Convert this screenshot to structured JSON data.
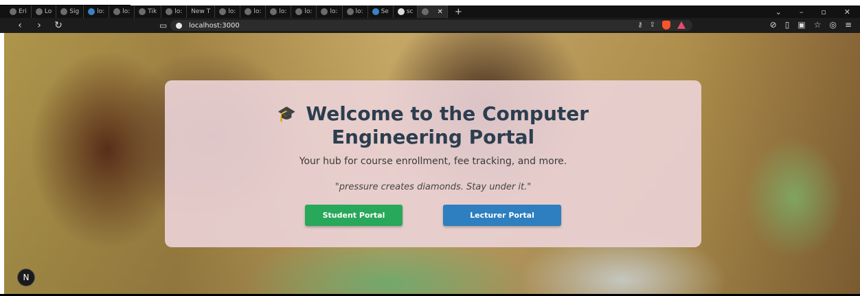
{
  "browser": {
    "tabs": [
      {
        "label": "Eri",
        "icon": "globe-icon"
      },
      {
        "label": "Lo",
        "icon": "globe-icon"
      },
      {
        "label": "Sig",
        "icon": "globe-icon"
      },
      {
        "label": "lo:",
        "icon": "react-icon"
      },
      {
        "label": "lo:",
        "icon": "globe-icon"
      },
      {
        "label": "Tik",
        "icon": "globe-icon"
      },
      {
        "label": "lo:",
        "icon": "globe-icon"
      },
      {
        "label": "New T",
        "icon": ""
      },
      {
        "label": "lo:",
        "icon": "globe-icon"
      },
      {
        "label": "lo:",
        "icon": "globe-icon"
      },
      {
        "label": "lo:",
        "icon": "globe-icon"
      },
      {
        "label": "lo:",
        "icon": "globe-icon"
      },
      {
        "label": "lo:",
        "icon": "globe-icon"
      },
      {
        "label": "lo:",
        "icon": "globe-icon"
      },
      {
        "label": "Se",
        "icon": "search-icon"
      },
      {
        "label": "sc",
        "icon": "github-icon"
      },
      {
        "label": "",
        "icon": "globe-icon",
        "active": true
      }
    ],
    "url": "localhost:3000"
  },
  "page": {
    "title_line1": "Welcome to the Computer",
    "title_line2": "Engineering Portal",
    "cap_icon": "🎓",
    "subtitle": "Your hub for course enrollment, fee tracking, and more.",
    "quote": "\"pressure creates diamonds. Stay under it.\"",
    "student_button": "Student Portal",
    "lecturer_button": "Lecturer Portal",
    "badge": "N"
  },
  "colors": {
    "title": "#2c3e50",
    "student_button": "#28a85a",
    "lecturer_button": "#2d7fbf"
  }
}
